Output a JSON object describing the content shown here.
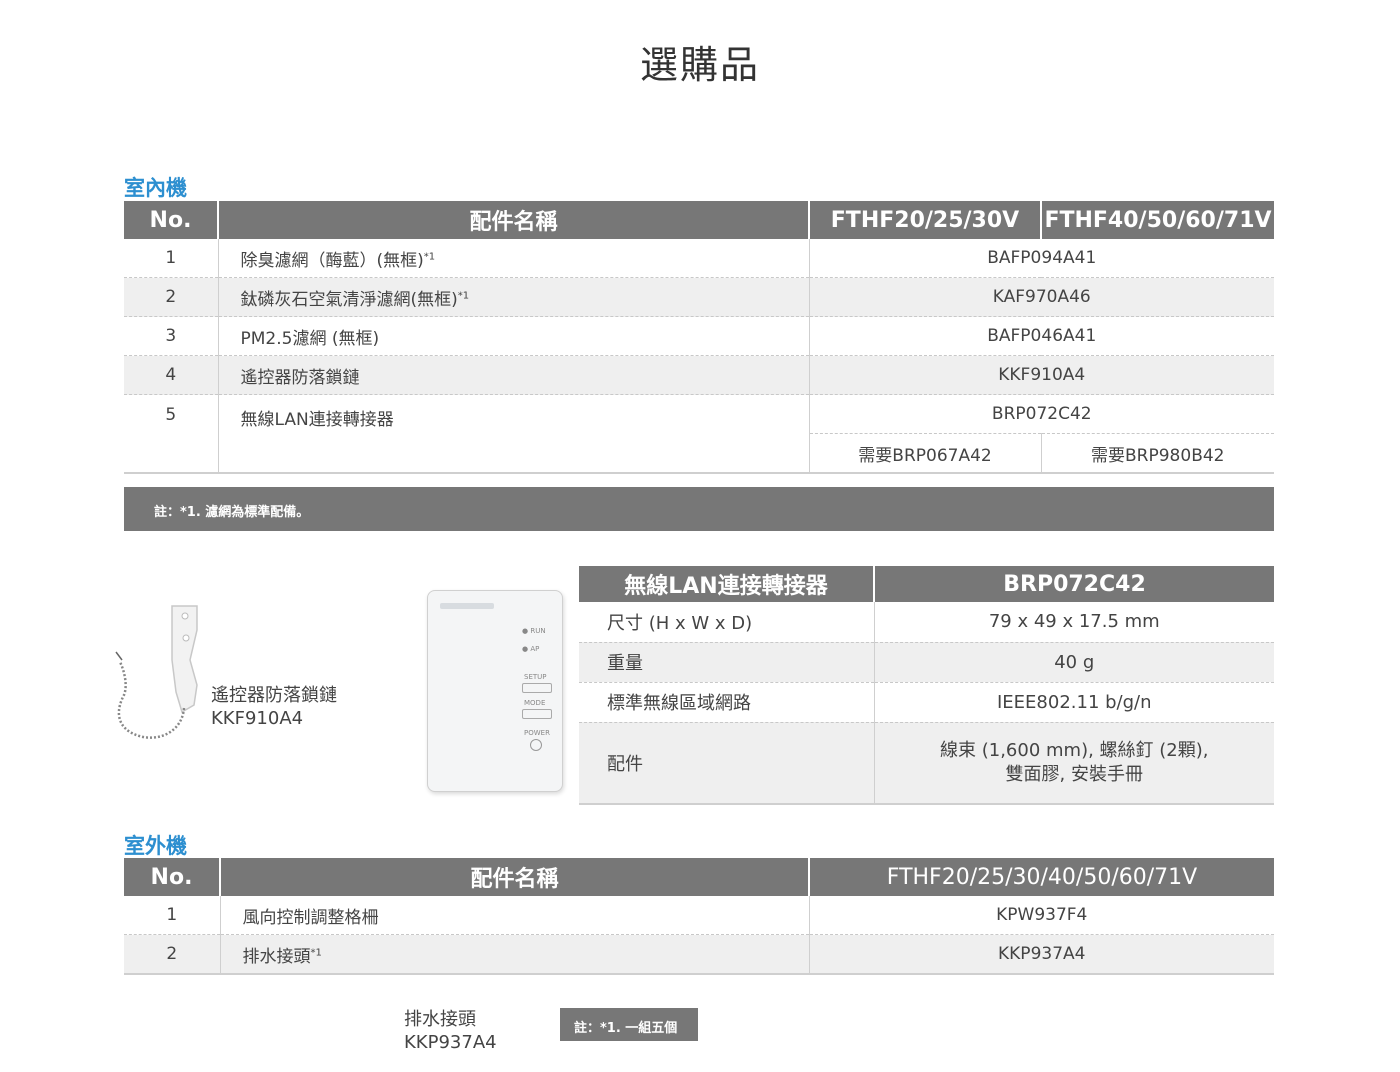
{
  "page_title": "選購品",
  "indoor": {
    "section_title": "室內機",
    "headers": [
      "No.",
      "配件名稱",
      "FTHF20/25/30V",
      "FTHF40/50/60/71V"
    ],
    "rows": [
      {
        "no": "1",
        "name": "除臭濾網（酶藍）(無框)",
        "sup": "*1",
        "code": "BAFP094A41"
      },
      {
        "no": "2",
        "name": "鈦磷灰石空氣清淨濾網(無框)",
        "sup": "*1",
        "code": "KAF970A46"
      },
      {
        "no": "3",
        "name": "PM2.5濾網 (無框)",
        "sup": "",
        "code": "BAFP046A41"
      },
      {
        "no": "4",
        "name": "遙控器防落鎖鏈",
        "sup": "",
        "code": "KKF910A4"
      },
      {
        "no": "5",
        "name": "無線LAN連接轉接器",
        "sup": "",
        "code": "BRP072C42"
      }
    ],
    "sub_left": "需要BRP067A42",
    "sub_right": "需要BRP980B42",
    "note": "註：*1. 濾網為標準配備。"
  },
  "chain": {
    "name": "遙控器防落鎖鏈",
    "code": "KKF910A4"
  },
  "adapter_device": {
    "run": "RUN",
    "ap": "AP",
    "setup": "SETUP",
    "mode": "MODE",
    "power": "POWER"
  },
  "spec": {
    "headers": [
      "無線LAN連接轉接器",
      "BRP072C42"
    ],
    "rows": [
      {
        "k": "尺寸 (H x W x D)",
        "v": "79 x 49 x 17.5 mm"
      },
      {
        "k": "重量",
        "v": "40 g"
      },
      {
        "k": "標準無線區域網路",
        "v": "IEEE802.11 b/g/n"
      },
      {
        "k": "配件",
        "v1": "線束 (1,600 mm), 螺絲釘 (2顆),",
        "v2": "雙面膠, 安裝手冊"
      }
    ]
  },
  "outdoor": {
    "section_title": "室外機",
    "headers": [
      "No.",
      "配件名稱",
      "FTHF20/25/30/40/50/60/71V"
    ],
    "rows": [
      {
        "no": "1",
        "name": "風向控制調整格柵",
        "sup": "",
        "code": "KPW937F4"
      },
      {
        "no": "2",
        "name": "排水接頭",
        "sup": "*1",
        "code": "KKP937A4"
      }
    ]
  },
  "drain": {
    "name": "排水接頭",
    "code": "KKP937A4",
    "note": "註：*1. 一組五個"
  },
  "colors": {
    "header_bg": "#777777",
    "accent": "#2d8fd0",
    "alt_row": "#efefef"
  }
}
